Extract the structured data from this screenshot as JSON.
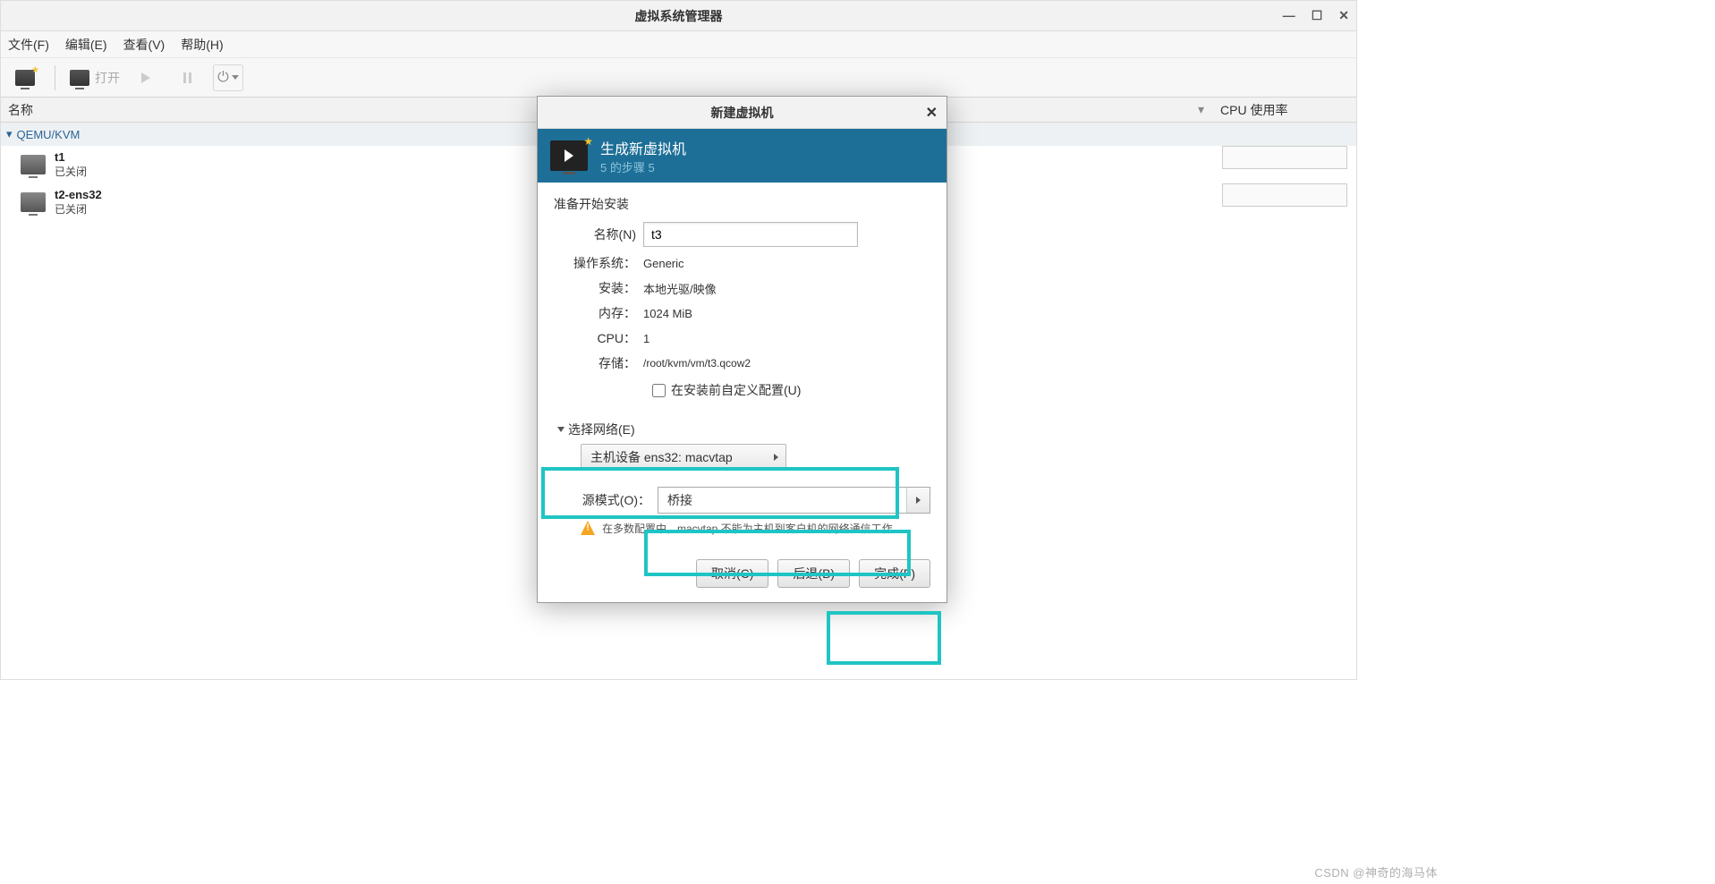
{
  "main": {
    "title": "虚拟系统管理器",
    "menus": [
      "文件(F)",
      "编辑(E)",
      "查看(V)",
      "帮助(H)"
    ],
    "toolbar": {
      "open_label": "打开"
    },
    "columns": {
      "name": "名称",
      "cpu": "CPU 使用率"
    },
    "group": "QEMU/KVM",
    "vms": [
      {
        "name": "t1",
        "state": "已关闭"
      },
      {
        "name": "t2-ens32",
        "state": "已关闭"
      }
    ]
  },
  "dialog": {
    "window_title": "新建虚拟机",
    "header_title": "生成新虚拟机",
    "step": "5 的步骤 5",
    "section_title": "准备开始安装",
    "name_label": "名称(N)",
    "name_value": "t3",
    "os_label": "操作系统：",
    "os_value": "Generic",
    "install_label": "安装：",
    "install_value": "本地光驱/映像",
    "mem_label": "内存：",
    "mem_value": "1024 MiB",
    "cpu_label": "CPU：",
    "cpu_value": "1",
    "storage_label": "存储：",
    "storage_value": "/root/kvm/vm/t3.qcow2",
    "customize_label": "在安装前自定义配置(U)",
    "net_expand": "选择网络(E)",
    "net_device": "主机设备 ens32: macvtap",
    "mode_label": "源模式(O)：",
    "mode_value": "桥接",
    "warn_text": "在多数配置中，macvtap 不能为主机到客户机的网络通信工作。",
    "cancel": "取消(C)",
    "back": "后退(B)",
    "finish": "完成(F)"
  },
  "watermark": "CSDN @神奇的海马体"
}
